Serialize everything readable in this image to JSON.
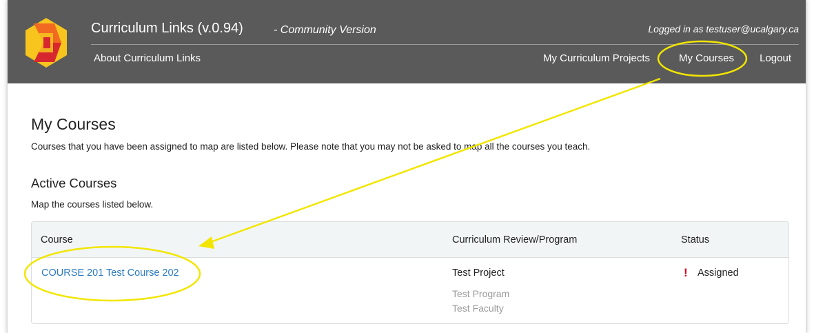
{
  "header": {
    "title": "Curriculum Links (v.0.94)",
    "subtitle": "- Community Version",
    "logged_in": "Logged in as testuser@ucalgary.ca",
    "nav": {
      "about": "About Curriculum Links",
      "projects": "My Curriculum Projects",
      "courses": "My Courses",
      "logout": "Logout"
    }
  },
  "main": {
    "title": "My Courses",
    "intro": "Courses that you have been assigned to map are listed below. Please note that you may not be asked to map all the courses you teach.",
    "section_title": "Active Courses",
    "section_sub": "Map the courses listed below.",
    "table": {
      "columns": [
        "Course",
        "Curriculum Review/Program",
        "Status"
      ],
      "rows": [
        {
          "course": "COURSE 201 Test Course 202",
          "project": "Test Project",
          "program": "Test Program",
          "faculty": "Test Faculty",
          "status_icon": "!",
          "status": "Assigned"
        }
      ]
    }
  },
  "colors": {
    "header_bg": "#5a5a5a",
    "link": "#2a7ac2",
    "annotation": "#f2e600",
    "status_alert": "#d0021b",
    "logo_orange": "#f26a21",
    "logo_red": "#d7282f",
    "logo_yellow": "#f7c51e"
  },
  "icons": {
    "logo": "curriculum-links-logo-icon",
    "status": "exclamation-icon"
  }
}
